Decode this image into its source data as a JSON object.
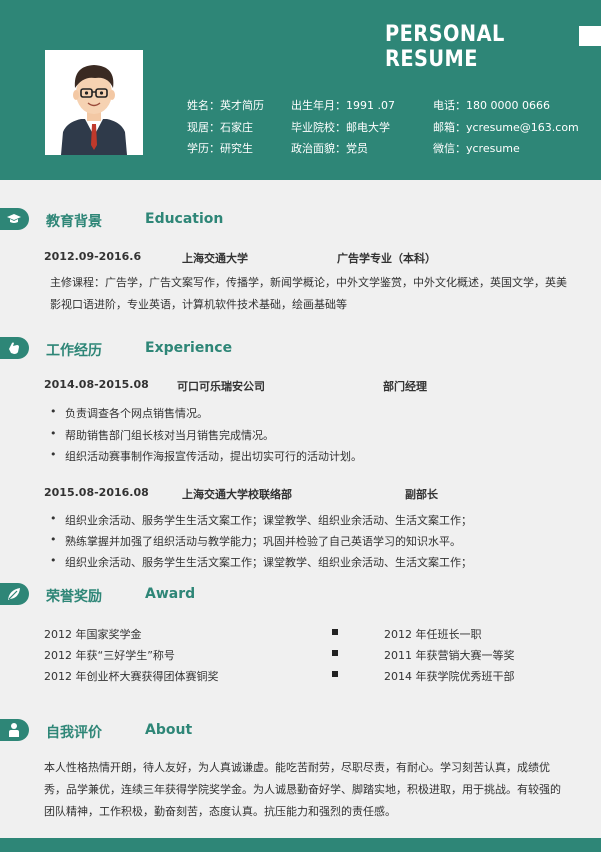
{
  "header": {
    "title": "PERSONAL RESUME",
    "info": {
      "name": "姓名：英才简历",
      "birth": "出生年月：1991 .07",
      "phone": "电话：180 0000 0666",
      "residence": "现居：石家庄",
      "school": "毕业院校：邮电大学",
      "email": "邮箱：ycresume@163.com",
      "education": "学历：研究生",
      "politics": "政治面貌：党员",
      "wechat": "微信：ycresume"
    }
  },
  "education": {
    "title_cn": "教育背景",
    "title_en": "Education",
    "period": "2012.09-2016.6",
    "school": "上海交通大学",
    "major": "广告学专业（本科）",
    "courses": "主修课程：广告学，广告文案写作，传播学，新闻学概论，中外文学鉴赏，中外文化概述，英国文学，英美影视口语进阶，专业英语，计算机软件技术基础，绘画基础等"
  },
  "experience": {
    "title_cn": "工作经历",
    "title_en": "Experience",
    "jobs": [
      {
        "period": "2014.08-2015.08",
        "company": "可口可乐瑞安公司",
        "role": "部门经理",
        "items": [
          "负责调查各个网点销售情况。",
          "帮助销售部门组长核对当月销售完成情况。",
          "组织活动赛事制作海报宣传活动，提出切实可行的活动计划。"
        ]
      },
      {
        "period": "2015.08-2016.08",
        "company": "上海交通大学校联络部",
        "role": "副部长",
        "items": [
          "组织业余活动、服务学生生活文案工作；课堂教学、组织业余活动、生活文案工作；",
          "熟练掌握并加强了组织活动与教学能力；巩固并检验了自己英语学习的知识水平。",
          "组织业余活动、服务学生生活文案工作；课堂教学、组织业余活动、生活文案工作；"
        ]
      }
    ]
  },
  "award": {
    "title_cn": "荣誉奖励",
    "title_en": "Award",
    "left": [
      "2012 年国家奖学金",
      "2012 年获“三好学生”称号",
      "2012 年创业杯大赛获得团体赛铜奖"
    ],
    "right": [
      "2012 年任班长一职",
      "2011 年获营销大赛一等奖",
      "2014 年获学院优秀班干部"
    ]
  },
  "about": {
    "title_cn": "自我评价",
    "title_en": "About",
    "text": "本人性格热情开朗，待人友好，为人真诚谦虚。能吃苦耐劳，尽职尽责，有耐心。学习刻苦认真，成绩优秀，品学兼优，连续三年获得学院奖学金。为人诚恳勤奋好学、脚踏实地，积极进取，用于挑战。有较强的团队精神，工作积极，勤奋刻苦，态度认真。抗压能力和强烈的责任感。"
  },
  "icons": {
    "education": "graduation-cap-icon",
    "experience": "hand-icon",
    "award": "leaf-icon",
    "about": "person-icon"
  },
  "colors": {
    "accent": "#2e8677",
    "background": "#f0f0f0"
  }
}
